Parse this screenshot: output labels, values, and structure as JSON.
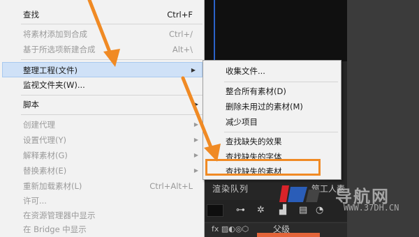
{
  "menu": {
    "items": [
      {
        "label": "查找",
        "shortcut": "Ctrl+F",
        "disabled": false
      },
      {
        "label": "将素材添加到合成",
        "shortcut": "Ctrl+/",
        "disabled": true
      },
      {
        "label": "基于所选项新建合成",
        "shortcut": "Alt+\\",
        "disabled": true
      },
      {
        "label": "整理工程(文件)",
        "shortcut": "",
        "disabled": false
      },
      {
        "label": "监视文件夹(W)...",
        "shortcut": "",
        "disabled": false
      },
      {
        "label": "脚本",
        "shortcut": "",
        "disabled": false
      },
      {
        "label": "创建代理",
        "shortcut": "",
        "disabled": true
      },
      {
        "label": "设置代理(Y)",
        "shortcut": "",
        "disabled": true
      },
      {
        "label": "解释素材(G)",
        "shortcut": "",
        "disabled": true
      },
      {
        "label": "替换素材(E)",
        "shortcut": "",
        "disabled": true
      },
      {
        "label": "重新加载素材(L)",
        "shortcut": "Ctrl+Alt+L",
        "disabled": true
      },
      {
        "label": "许可...",
        "shortcut": "",
        "disabled": true
      },
      {
        "label": "在资源管理器中显示",
        "shortcut": "",
        "disabled": true
      },
      {
        "label": "在 Bridge 中显示",
        "shortcut": "",
        "disabled": true
      }
    ]
  },
  "submenu": {
    "items": [
      {
        "label": "收集文件..."
      },
      {
        "label": "整合所有素材(D)"
      },
      {
        "label": "删除未用过的素材(M)"
      },
      {
        "label": "减少项目"
      },
      {
        "label": "查找缺失的效果"
      },
      {
        "label": "查找缺失的字体"
      },
      {
        "label": "查找缺失的素材"
      }
    ]
  },
  "app": {
    "panel_tab": "渲染队列",
    "panel_tab_partial": "筑工人素",
    "bottom_label": "父级",
    "bottom_fx": "fx"
  },
  "watermark": {
    "text": "导航网",
    "url": "WWW.37DH.CN"
  },
  "colors": {
    "highlight": "#cfe1f7",
    "annotation_orange": "#f08a24",
    "disabled_text": "#9a9a9a"
  }
}
